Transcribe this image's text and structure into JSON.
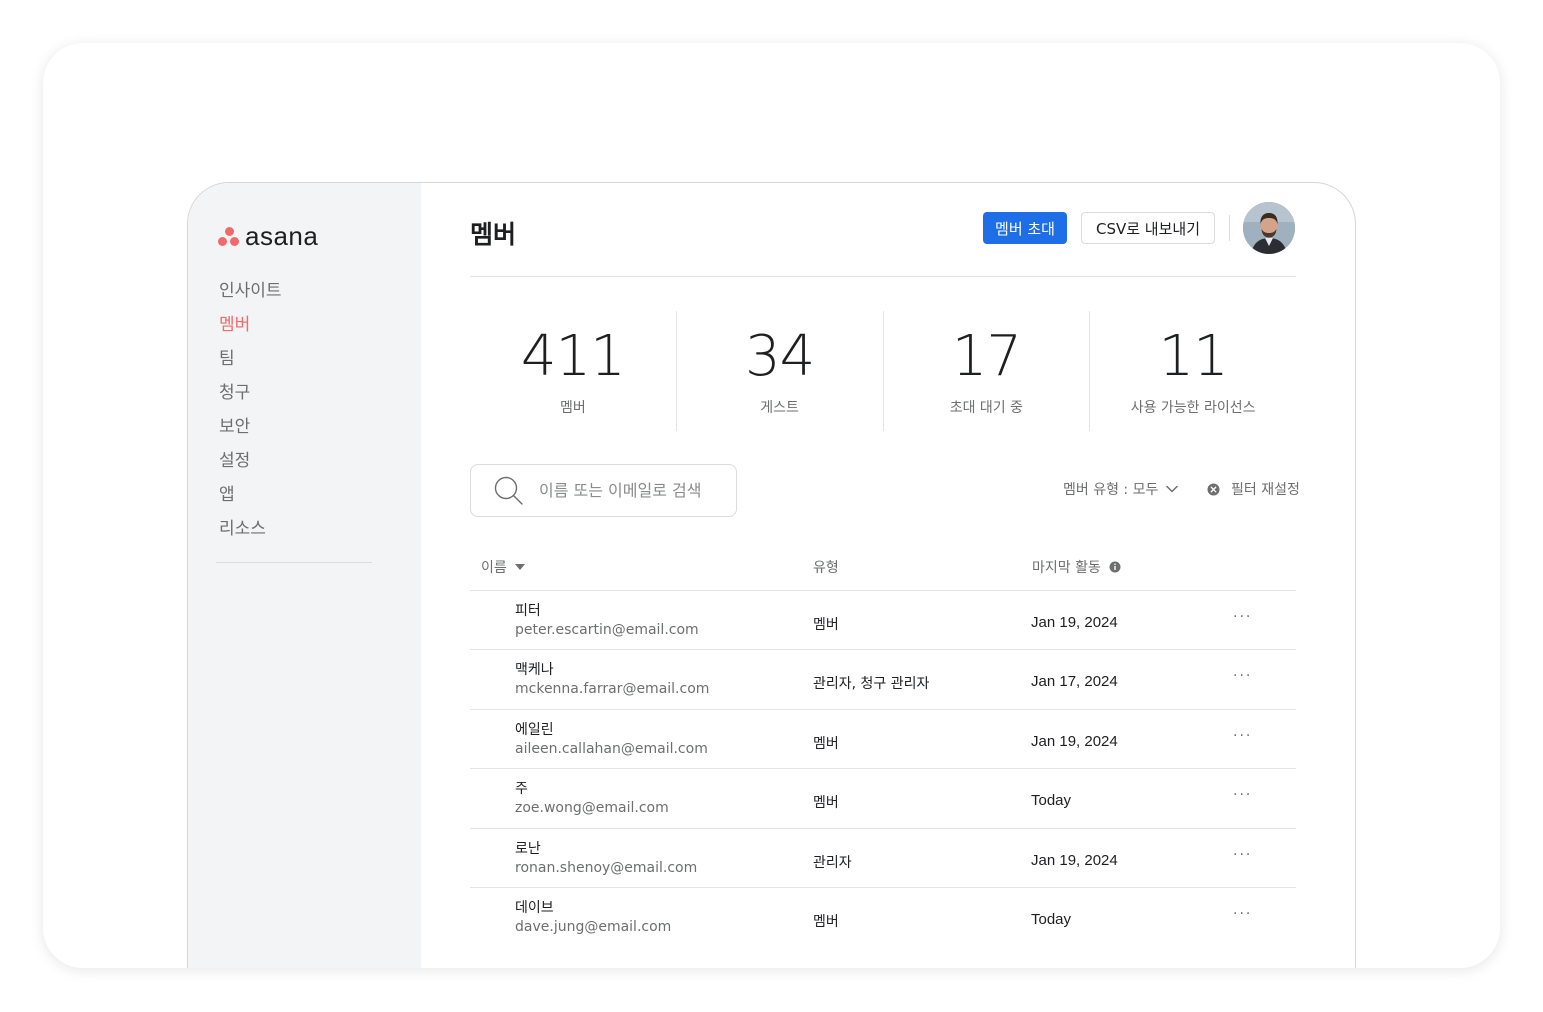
{
  "brand": {
    "name": "asana",
    "accent": "#f06a6a",
    "primary": "#1e6ee8"
  },
  "sidebar": {
    "items": [
      {
        "label": "인사이트",
        "active": false
      },
      {
        "label": "멤버",
        "active": true
      },
      {
        "label": "팀",
        "active": false
      },
      {
        "label": "청구",
        "active": false
      },
      {
        "label": "보안",
        "active": false
      },
      {
        "label": "설정",
        "active": false
      },
      {
        "label": "앱",
        "active": false
      },
      {
        "label": "리소스",
        "active": false
      }
    ]
  },
  "header": {
    "title": "멤버",
    "invite_label": "멤버 초대",
    "export_label": "CSV로 내보내기"
  },
  "stats": [
    {
      "value": "411",
      "label": "멤버"
    },
    {
      "value": "34",
      "label": "게스트"
    },
    {
      "value": "17",
      "label": "초대 대기 중"
    },
    {
      "value": "11",
      "label": "사용 가능한 라이선스"
    }
  ],
  "search": {
    "placeholder": "이름 또는 이메일로 검색",
    "value": ""
  },
  "filters": {
    "member_type_label": "멤버 유형 : 모두",
    "reset_label": "필터 재설정"
  },
  "table": {
    "columns": {
      "name": "이름",
      "type": "유형",
      "last_activity": "마지막 활동"
    },
    "rows": [
      {
        "name": "피터",
        "email": "peter.escartin@email.com",
        "type": "멤버",
        "last_activity": "Jan 19, 2024",
        "more": "···"
      },
      {
        "name": "맥케나",
        "email": "mckenna.farrar@email.com",
        "type": "관리자, 청구 관리자",
        "last_activity": "Jan 17, 2024",
        "more": "···"
      },
      {
        "name": "에일린",
        "email": "aileen.callahan@email.com",
        "type": "멤버",
        "last_activity": "Jan 19, 2024",
        "more": "···"
      },
      {
        "name": "주",
        "email": "zoe.wong@email.com",
        "type": "멤버",
        "last_activity": "Today",
        "more": "···"
      },
      {
        "name": "로난",
        "email": "ronan.shenoy@email.com",
        "type": "관리자",
        "last_activity": "Jan 19, 2024",
        "more": "···"
      },
      {
        "name": "데이브",
        "email": "dave.jung@email.com",
        "type": "멤버",
        "last_activity": "Today",
        "more": "···"
      }
    ]
  }
}
